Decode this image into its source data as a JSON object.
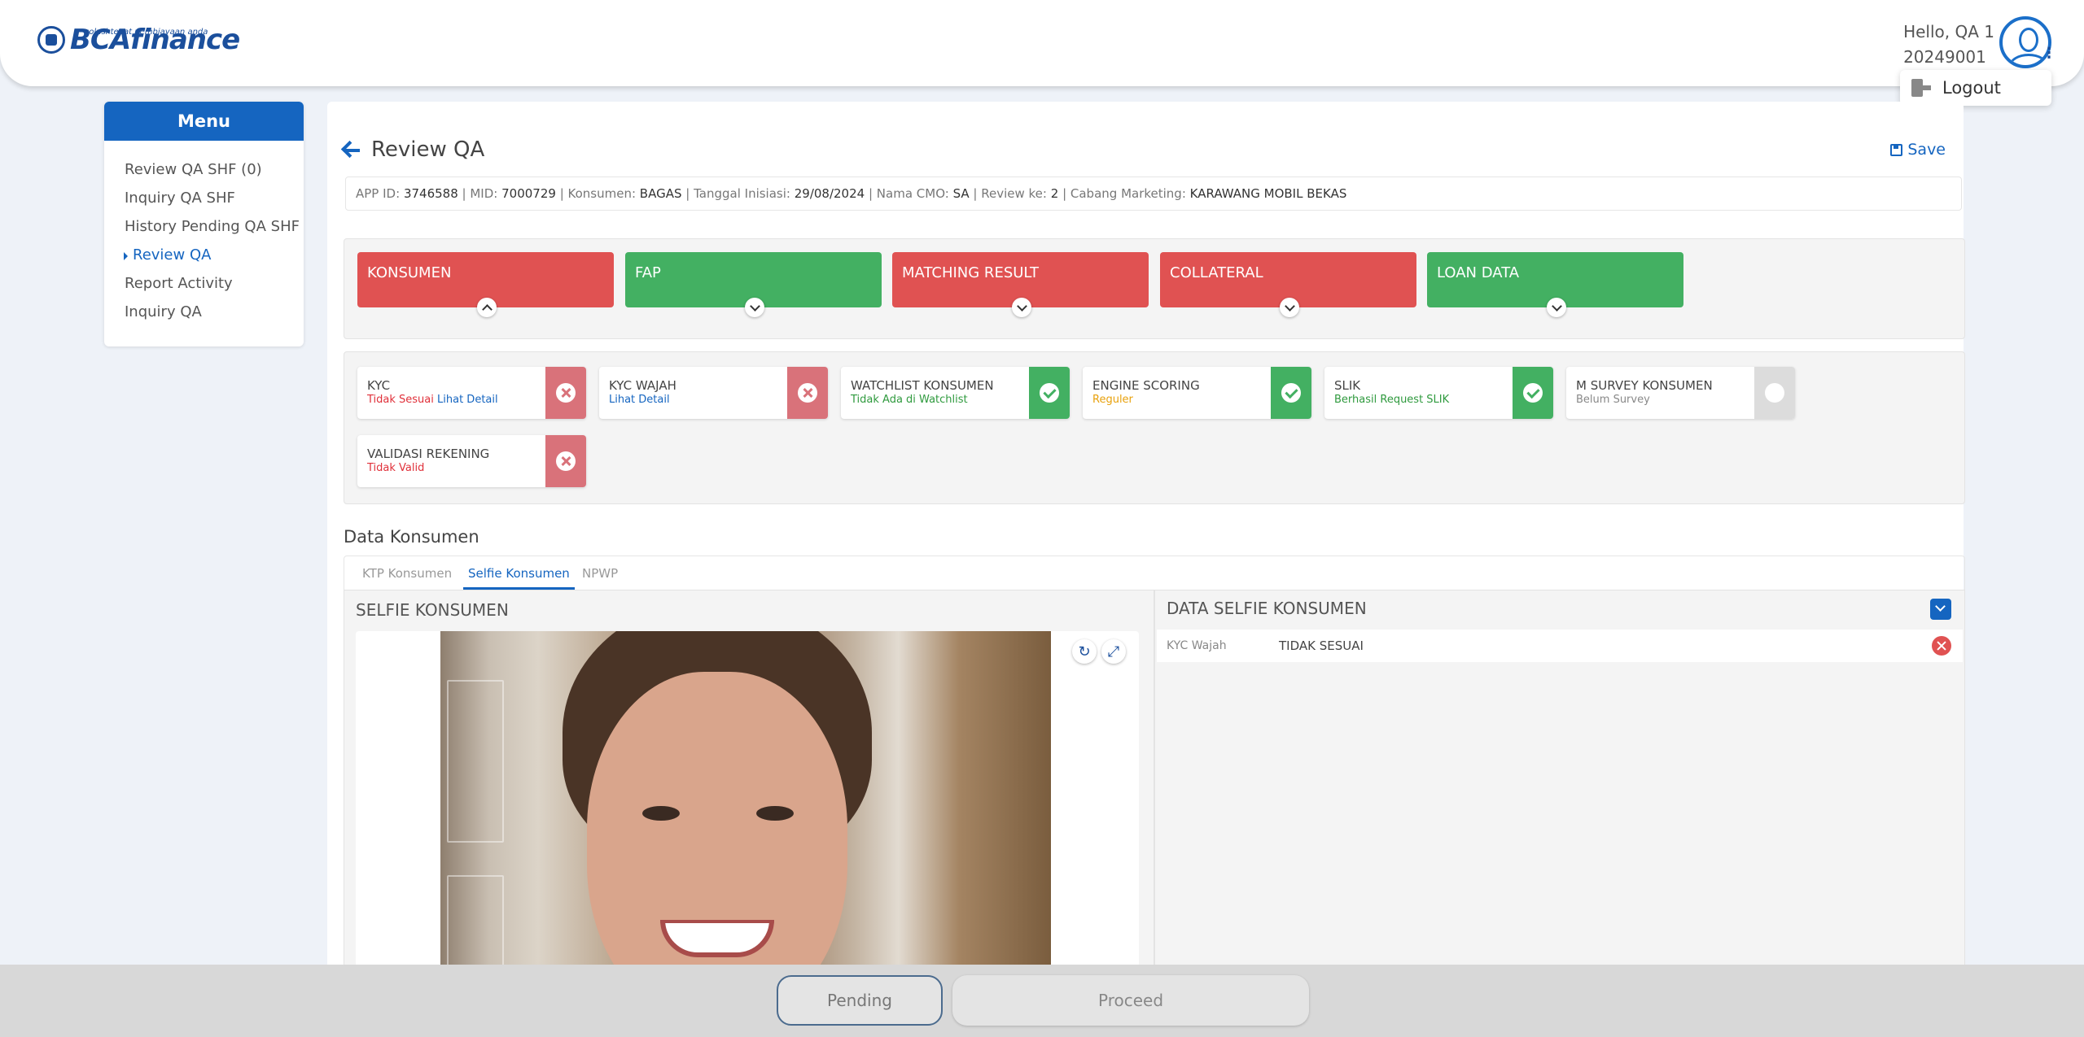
{
  "header": {
    "brand": "BCAfinance",
    "tagline": "solusi tepat pembiayaan anda",
    "greeting": "Hello, QA 1",
    "user_id": "20249001",
    "logout_label": "Logout"
  },
  "sidebar": {
    "title": "Menu",
    "items": [
      {
        "label": "Review QA SHF (0)"
      },
      {
        "label": "Inquiry QA SHF"
      },
      {
        "label": "History Pending QA SHF"
      },
      {
        "label": "Review QA"
      },
      {
        "label": "Report Activity"
      },
      {
        "label": "Inquiry QA"
      }
    ],
    "active_item": "Review QA"
  },
  "page": {
    "title": "Review QA",
    "save_label": "Save"
  },
  "info": {
    "app_id_label": "APP ID:",
    "app_id": "3746588",
    "mid_label": "MID:",
    "mid": "7000729",
    "konsumen_label": "Konsumen:",
    "konsumen": "BAGAS",
    "tgl_label": "Tanggal Inisiasi:",
    "tgl": "29/08/2024",
    "cmo_label": "Nama CMO:",
    "cmo": "SA",
    "review_label": "Review ke:",
    "review": "2",
    "cabang_label": "Cabang Marketing:",
    "cabang": "KARAWANG MOBIL BEKAS"
  },
  "tiles": [
    {
      "label": "KONSUMEN",
      "status": "red",
      "expanded": true
    },
    {
      "label": "FAP",
      "status": "green",
      "expanded": false
    },
    {
      "label": "MATCHING RESULT",
      "status": "red",
      "expanded": false
    },
    {
      "label": "COLLATERAL",
      "status": "red",
      "expanded": false
    },
    {
      "label": "LOAN DATA",
      "status": "green",
      "expanded": false
    }
  ],
  "checks": [
    {
      "name": "KYC",
      "status_text": "Tidak Sesuai",
      "link": "Lihat Detail",
      "state": "bad"
    },
    {
      "name": "KYC WAJAH",
      "status_text": "",
      "link": "Lihat Detail",
      "state": "bad"
    },
    {
      "name": "WATCHLIST KONSUMEN",
      "status_text": "Tidak Ada di Watchlist",
      "state": "ok"
    },
    {
      "name": "ENGINE SCORING",
      "status_text": "Reguler",
      "state": "ok"
    },
    {
      "name": "SLIK",
      "status_text": "Berhasil Request SLIK",
      "state": "ok"
    },
    {
      "name": "M SURVEY KONSUMEN",
      "status_text": "Belum Survey",
      "state": "na"
    },
    {
      "name": "VALIDASI REKENING",
      "status_text": "Tidak Valid",
      "state": "bad"
    }
  ],
  "data_konsumen": {
    "title": "Data Konsumen",
    "tabs": [
      "KTP Konsumen",
      "Selfie Konsumen",
      "NPWP"
    ],
    "active_tab": "Selfie Konsumen",
    "left_title": "SELFIE KONSUMEN",
    "right_title": "DATA SELFIE KONSUMEN",
    "kyc_key": "KYC Wajah",
    "kyc_value": "TIDAK SESUAI"
  },
  "footer": {
    "pending_label": "Pending",
    "proceed_label": "Proceed"
  },
  "colors": {
    "primary": "#1565c0",
    "fail": "#e05252",
    "pass": "#43b062"
  }
}
